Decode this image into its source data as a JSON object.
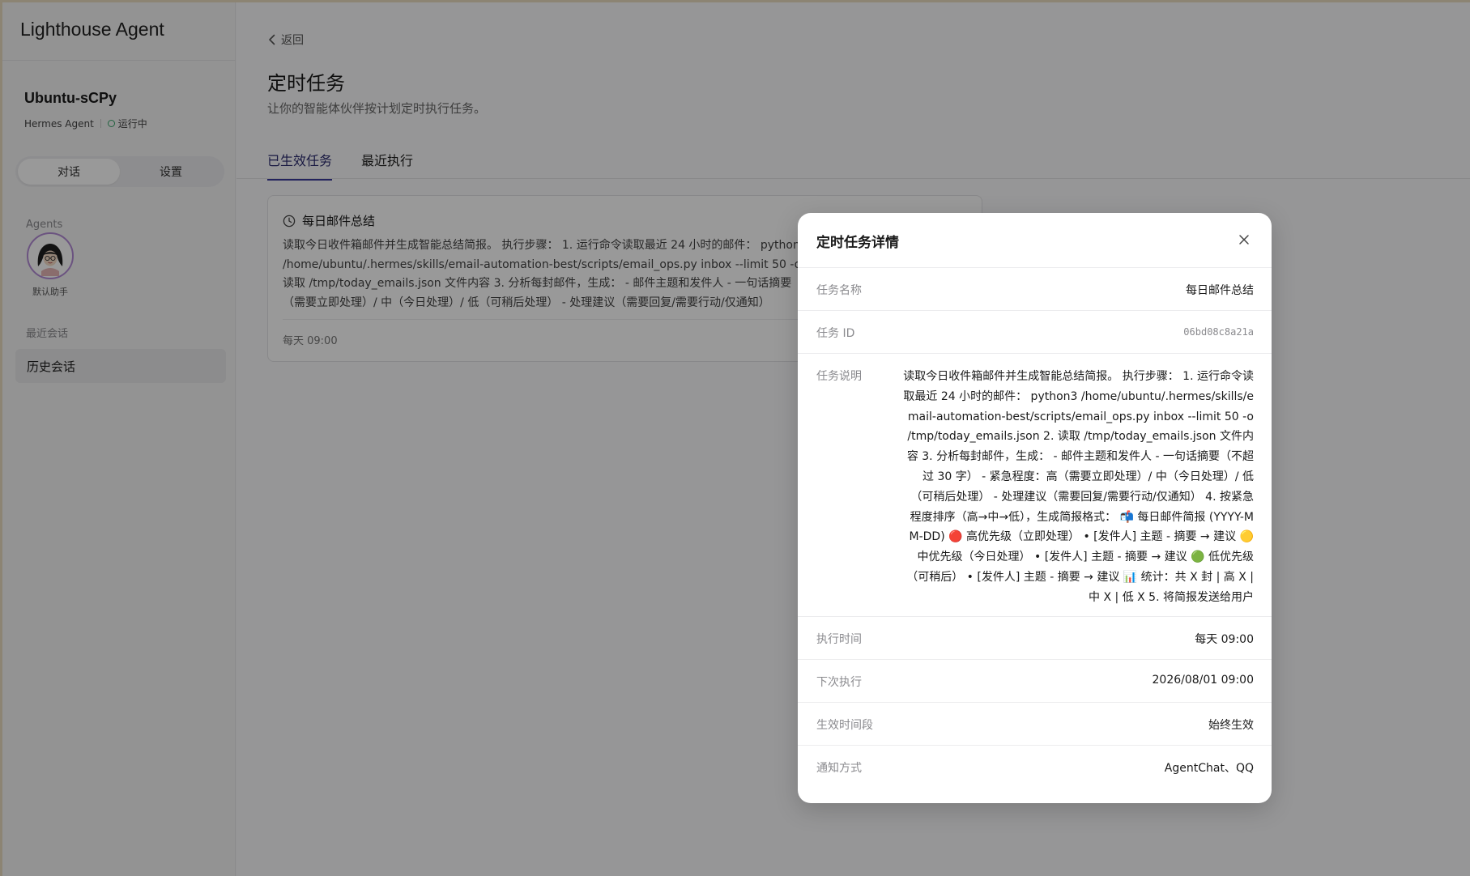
{
  "sidebar": {
    "brand": "Lighthouse Agent",
    "instance_name": "Ubuntu-sCPy",
    "instance_type": "Hermes Agent",
    "instance_status": "运行中",
    "segments": [
      {
        "label": "对话",
        "active": true
      },
      {
        "label": "设置",
        "active": false
      }
    ],
    "agents_label": "Agents",
    "agent_caption": "默认助手",
    "recent_label": "最近会话",
    "history_item": "历史会话"
  },
  "main": {
    "back_label": "返回",
    "title": "定时任务",
    "subtitle": "让你的智能体伙伴按计划定时执行任务。",
    "tabs": [
      {
        "label": "已生效任务",
        "active": true
      },
      {
        "label": "最近执行",
        "active": false
      }
    ],
    "task_card": {
      "title": "每日邮件总结",
      "description": "读取今日收件箱邮件并生成智能总结简报。 执行步骤： 1. 运行命令读取最近 24 小时的邮件： python3 /home/ubuntu/.hermes/skills/email-automation-best/scripts/email_ops.py inbox --limit 50 -o /tmp/today_emails.json 2. 读取 /tmp/today_emails.json 文件内容 3. 分析每封邮件，生成： - 邮件主题和发件人 - 一句话摘要（不超过 30 字） - 紧急程度：高（需要立即处理）/ 中（今日处理）/ 低（可稍后处理） - 处理建议（需要回复/需要行动/仅通知）",
      "schedule": "每天 09:00"
    }
  },
  "modal": {
    "title": "定时任务详情",
    "rows": {
      "name": {
        "label": "任务名称",
        "value": "每日邮件总结"
      },
      "id": {
        "label": "任务 ID",
        "value": "06bd08c8a21a"
      },
      "description": {
        "label": "任务说明",
        "value": "读取今日收件箱邮件并生成智能总结简报。 执行步骤： 1. 运行命令读取最近 24 小时的邮件： python3 /home/ubuntu/.hermes/skills/email-automation-best/scripts/email_ops.py inbox --limit 50 -o /tmp/today_emails.json 2. 读取 /tmp/today_emails.json 文件内容 3. 分析每封邮件，生成： - 邮件主题和发件人 - 一句话摘要（不超过 30 字） - 紧急程度：高（需要立即处理）/ 中（今日处理）/ 低（可稍后处理） - 处理建议（需要回复/需要行动/仅通知） 4. 按紧急程度排序（高→中→低），生成简报格式： 📬 每日邮件简报 (YYYY-MM-DD) 🔴 高优先级（立即处理） • [发件人] 主题 - 摘要 → 建议 🟡 中优先级（今日处理） • [发件人] 主题 - 摘要 → 建议 🟢 低优先级（可稍后） • [发件人] 主题 - 摘要 → 建议 📊 统计：共 X 封 | 高 X | 中 X | 低 X 5. 将简报发送给用户"
      },
      "exec_time": {
        "label": "执行时间",
        "value": "每天 09:00"
      },
      "next_run": {
        "label": "下次执行",
        "value": "2026/08/01 09:00"
      },
      "period": {
        "label": "生效时间段",
        "value": "始终生效"
      },
      "notify": {
        "label": "通知方式",
        "value": "AgentChat、QQ"
      }
    }
  },
  "colors": {
    "accent": "#3b3b9c",
    "status_running": "#3aa56b",
    "overlay": "rgba(0,0,0,0.40)"
  },
  "icons": [
    "chevron-left-icon",
    "clock-icon",
    "close-icon",
    "status-dot-icon",
    "agent-avatar"
  ]
}
